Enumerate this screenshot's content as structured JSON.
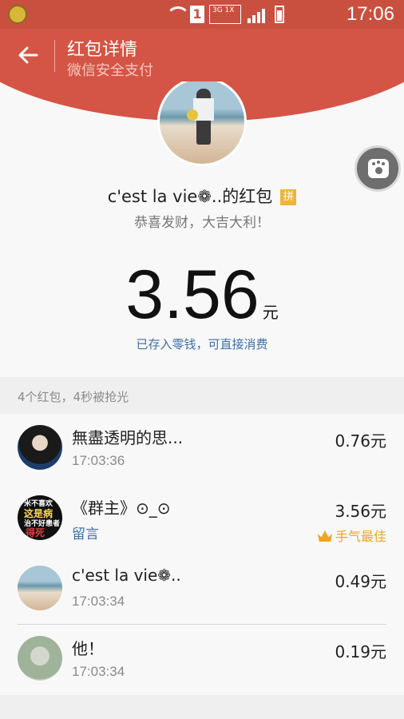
{
  "status_bar": {
    "time": "17:06",
    "sim_slot": "1",
    "network": "3G 1X",
    "colors": {
      "bar": "#c9503f"
    }
  },
  "header": {
    "title": "红包详情",
    "subtitle": "微信安全支付",
    "back_icon": "arrow-left-icon"
  },
  "envelope": {
    "sender": "c'est la vie❁..的红包",
    "badge": "拼",
    "greeting": "恭喜发财，大吉大利！",
    "amount": "3.56",
    "unit": "元",
    "stored_text": "已存入零钱，可直接消费",
    "float_button_icon": "paw-icon"
  },
  "summary": "4个红包，4秒被抢光",
  "recipients": [
    {
      "name": "無盡透明的思...",
      "time": "17:03:36",
      "amount": "0.76元"
    },
    {
      "name": "《群主》⊙_⊙",
      "message": "留言",
      "amount": "3.56元",
      "best_label": "手气最佳"
    },
    {
      "name": "c'est la vie❁..",
      "time": "17:03:34",
      "amount": "0.49元"
    },
    {
      "name": "他！",
      "time": "17:03:34",
      "amount": "0.19元"
    }
  ],
  "avatar2_text": [
    "米不喜欢",
    "这是病",
    "治不好患者",
    "得死"
  ],
  "colors": {
    "accent": "#d45545",
    "link": "#3e6ea5",
    "best": "#f0a424"
  }
}
